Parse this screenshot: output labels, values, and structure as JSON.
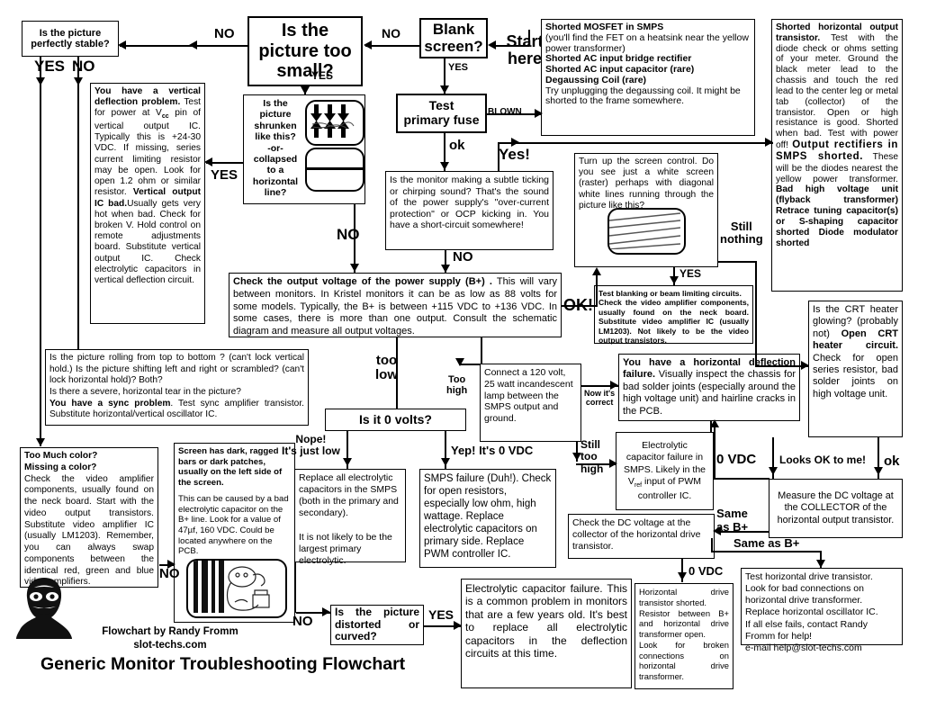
{
  "title": "Generic Monitor Troubleshooting Flowchart",
  "credit": {
    "line1": "Flowchart by Randy Fromm",
    "line2": "slot-techs.com"
  },
  "start_label": "Start\nhere",
  "nodes": {
    "stable": "Is the picture\nperfectly stable?",
    "too_small": "Is the\npicture too\nsmall?",
    "blank": "Blank\nscreen?",
    "test_fuse": "Test\nprimary fuse",
    "shrunken": "Is the\npicture\nshrunken\nlike this?\n-or-\ncollapsed\nto a\nhorizontal\nline?",
    "is_zero_volts": "Is it 0 volts?",
    "distorted": "Is the picture distorted or curved?"
  },
  "panels": {
    "vertical_deflection": {
      "p1_b": "You have a vertical deflection problem.",
      "p1": "Test for power at V",
      "p1_sub": "cc",
      "p1_rest": " pin of vertical output IC. Typically this is +24-30 VDC. If missing, series current limiting resistor may be open. Look for open 1.2 ohm or similar resistor.",
      "p2_b": "Vertical output IC bad.",
      "p2": "Usually gets very hot when bad. Check for broken V. Hold control on remote adjustments board.",
      "p3": "Substitute vertical output IC.  Check electrolytic capacitors in vertical deflection circuit."
    },
    "mosfet": {
      "l1": "Shorted MOSFET in SMPS",
      "l2": "(you'll find the FET on a heatsink near the yellow power transformer)",
      "l3": "Shorted AC input bridge rectifier",
      "l4": "Shorted AC input capacitor (rare)",
      "l5": "Degaussing Coil (rare)",
      "l6": "Try unplugging the degaussing coil.  It might be shorted to the frame somewhere."
    },
    "shorted_hot": {
      "b1": "Shorted horizontal output transistor.",
      "t1": " Test with the diode check or ohms setting of your meter. Ground the black meter lead to the chassis and touch the red lead to the center leg or metal tab (collector) of the transistor. Open or high resistance is good.  Shorted when bad.  Test with power off!",
      "b2": "Output rectifiers  in SMPS shorted.",
      "t2": " These will be the diodes nearest the yellow power transformer.",
      "b3": "Bad high voltage unit (flyback transformer)",
      "b4": "Retrace tuning capacitor(s) or S-shaping capacitor shorted",
      "b5": "Diode modulator shorted"
    },
    "ticking": "Is the monitor making a subtle ticking or chirping sound? That's the sound of the power supply's \"over-current protection\" or OCP kicking in. You have a short-circuit somewhere!",
    "screen_control": "Turn up the screen control. Do you see just a white screen (raster) perhaps with diagonal white lines running through the picture like this?",
    "check_bplus_b": "Check the output voltage of the power supply (B+) .",
    "check_bplus": " This will vary between monitors. In Kristel monitors it can be as low as 88 volts for some models. Typically, the B+ is between +115 VDC to +136 VDC. In some cases, there is more than one  output. Consult the schematic diagram and measure all output voltages.",
    "sync": {
      "l1": "Is the picture rolling from top to bottom ? (can't lock vertical hold.) Is the picture shifting left and right or scrambled? (can't lock horizontal hold)? Both?",
      "l2": "Is there a severe, horizontal tear in the picture?",
      "b": "You  have a  sync problem",
      "l3": ". Test sync amplifier transistor.  Substitute  horizontal/vertical oscillator IC."
    },
    "blanking": "Test blanking or beam limiting circuits.\nCheck the video amplifier components, usually found on the neck board.  Substitute video amplifier IC (usually LM1203). Not likely to be the video output transistors.",
    "crt_heater": {
      "t1": "Is the CRT heater glowing? (probably not) ",
      "b1": "Open CRT heater circuit.",
      "t2": " Check for open series resistor, bad solder joints on high voltage unit."
    },
    "lamp": "Connect a 120 volt, 25 watt incandescent lamp between the SMPS output and ground.",
    "horiz_deflection_b": "You have a horizontal deflection failure.",
    "horiz_deflection": " Visually inspect the chassis for bad solder joints (especially around the high voltage unit) and hairline cracks in the PCB.",
    "too_much_color": {
      "b1": "Too Much color?",
      "b2": "Missing a color?",
      "t": "Check the video amplifier components, usually found on the neck board. Start with the video output transistors. Substitute video amplifier IC (usually LM1203). Remember, you can always swap components between the identical red, green and blue video amplifiers."
    },
    "dark_bars": {
      "b": "Screen has dark, ragged bars or dark patches, usually on the left side of the screen.",
      "t": "This can be caused by a bad electrolytic capacitor on the B+ line. Look for a value of 47µf, 160 VDC. Could be located anywhere on the PCB."
    },
    "replace_caps": "Replace all electrolytic capacitors in the SMPS (both in the primary and secondary).\n\nIt is not likely to be the largest primary electrolytic.",
    "smps_failure": "SMPS failure (Duh!). Check for open resistors, especially low ohm, high wattage. Replace electrolytic capacitors on primary side. Replace PWM controller IC.",
    "electrolytic_smps": {
      "l1": "Electrolytic",
      "l2": "capacitor failure in",
      "l3": "SMPS. Likely in the",
      "l4": "V",
      "l4_sub": "ref",
      "l4_rest": "  input of PWM",
      "l5": "controller IC."
    },
    "measure_collector": "Measure the DC voltage at the COLLECTOR  of the horizontal output transistor.",
    "check_dc_drive": "Check the DC voltage at the collector of the horizontal drive transistor.",
    "electrolytic_common": "Electrolytic capacitor failure. This is a common problem in monitors that are a few years old. It's best to replace all electrolytic capacitors in the deflection circuits at this time.",
    "horiz_drive_shorted": "Horizontal drive transistor shorted.\nResistor between B+ and horizontal drive transformer open.\nLook for broken connections on horizontal drive transformer.",
    "test_horiz_drive": "Test horizontal drive transistor.\nLook for bad connections on horizontal drive transformer.\nReplace horizontal oscillator IC.\nIf all else fails, contact Randy Fromm for help!\ne-mail  help@slot-techs.com"
  },
  "edges": {
    "no_blank_to_small": "NO",
    "no_small_to_stable": "NO",
    "yes_stable": "YES",
    "no_stable": "NO",
    "yes_small": "YES",
    "yes_blank": "YES",
    "blown": "BLOWN",
    "ok_fuse": "ok",
    "yes_ticking": "Yes!",
    "no_ticking": "NO",
    "yes_shrunken": "YES",
    "no_shrunken": "NO",
    "ok_bplus": "OK!",
    "still_nothing": "Still\nnothing",
    "yes_screen": "YES",
    "too_low": "too\nlow",
    "too_high": "Too\nhigh",
    "nope": "Nope!\nIt's just low",
    "yep": "Yep! It's 0 VDC",
    "still_too_high": "Still\ntoo\nhigh",
    "now_correct": "Now it's\ncorrect",
    "looks_ok": "Looks OK to me!",
    "ok_crt": "ok",
    "zero_vdc_left": "0 VDC",
    "same_as_bplus": "Same\nas B+",
    "same_as_bplus2": "Same as B+",
    "zero_vdc_mid": "0 VDC",
    "no_color": "NO",
    "no_dark": "NO",
    "yes_distorted": "YES"
  }
}
